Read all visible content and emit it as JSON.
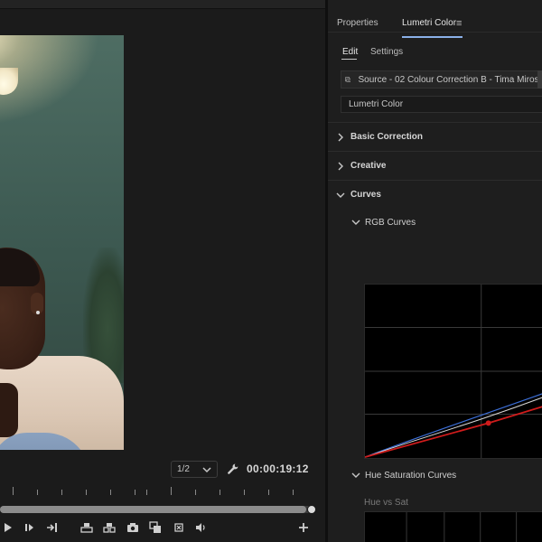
{
  "monitor": {
    "zoom_value": "1/2",
    "timecode": "00:00:19:12",
    "playhead_progress": 0.98
  },
  "panel": {
    "tabs": [
      {
        "label": "Properties"
      },
      {
        "label": "Lumetri Color"
      }
    ],
    "subtabs": [
      {
        "label": "Edit"
      },
      {
        "label": "Settings"
      }
    ],
    "source_label": "Source - 02 Colour Correction B - Tima Miroshn...",
    "effect_label": "Lumetri Color",
    "sections": [
      {
        "label": "Basic Correction",
        "expanded": false
      },
      {
        "label": "Creative",
        "expanded": false
      },
      {
        "label": "Curves",
        "expanded": true
      }
    ],
    "rgb_curves_label": "RGB Curves",
    "hue_sat_label": "Hue Saturation Curves",
    "hue_vs_sat_label": "Hue vs Sat"
  },
  "colors": {
    "accent_tab": "#8ab0e8",
    "curve_red": "#d01c1c",
    "curve_blue": "#3c6fd8",
    "curve_white": "#d8d8d8"
  }
}
